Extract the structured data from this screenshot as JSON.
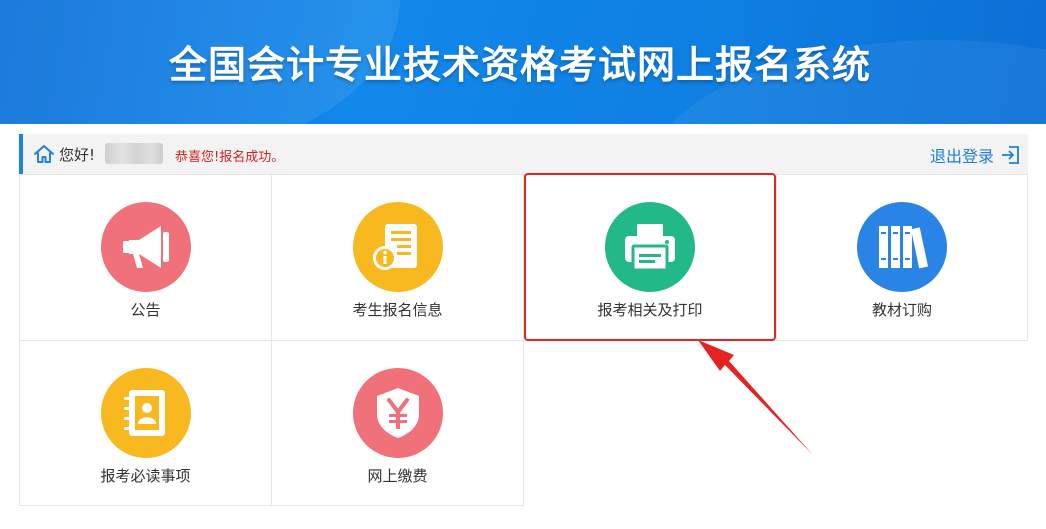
{
  "header": {
    "title": "全国会计专业技术资格考试网上报名系统"
  },
  "toolbar": {
    "greeting": "您好!",
    "success_message": "恭喜您!报名成功。",
    "logout_label": "退出登录",
    "accent_color": "#1e82e0",
    "message_color": "#d4201f"
  },
  "tiles": [
    {
      "label": "公告",
      "icon": "megaphone-icon",
      "color": "#f0717a"
    },
    {
      "label": "考生报名信息",
      "icon": "info-document-icon",
      "color": "#f8b820"
    },
    {
      "label": "报考相关及打印",
      "icon": "printer-icon",
      "color": "#22b889"
    },
    {
      "label": "教材订购",
      "icon": "books-icon",
      "color": "#2a84e6"
    },
    {
      "label": "报考必读事项",
      "icon": "contact-book-icon",
      "color": "#f8b820"
    },
    {
      "label": "网上缴费",
      "icon": "yuan-shield-icon",
      "color": "#f0717a"
    }
  ]
}
